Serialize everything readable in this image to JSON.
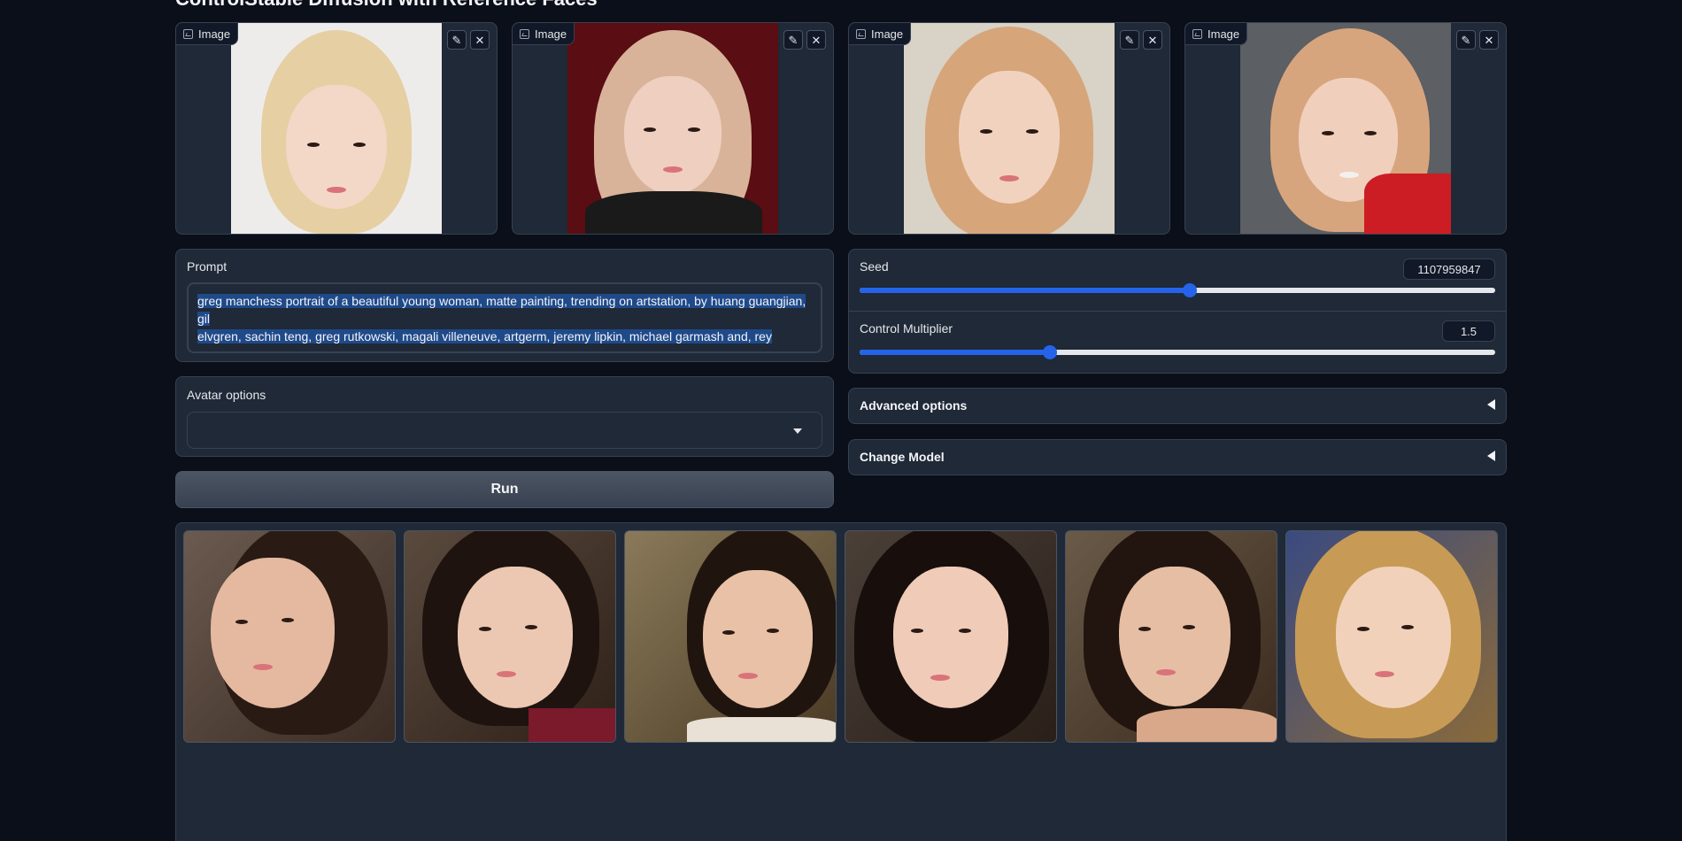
{
  "page": {
    "title": "ControlStable Diffusion with Reference Faces"
  },
  "reference_images": [
    {
      "label": "Image",
      "edit_icon": "pencil-icon",
      "close_icon": "close-icon"
    },
    {
      "label": "Image",
      "edit_icon": "pencil-icon",
      "close_icon": "close-icon"
    },
    {
      "label": "Image",
      "edit_icon": "pencil-icon",
      "close_icon": "close-icon"
    },
    {
      "label": "Image",
      "edit_icon": "pencil-icon",
      "close_icon": "close-icon"
    }
  ],
  "prompt": {
    "label": "Prompt",
    "value_line1": "greg manchess portrait of a beautiful young woman, matte painting, trending on artstation, by huang guangjian, gil",
    "value_line2": "elvgren, sachin teng, greg rutkowski, magali villeneuve, artgerm, jeremy lipkin, michael garmash and, rey"
  },
  "avatar_options": {
    "label": "Avatar options",
    "selected": ""
  },
  "run_button": {
    "label": "Run"
  },
  "seed": {
    "label": "Seed",
    "value": "1107959847",
    "fraction": 0.52
  },
  "control_multiplier": {
    "label": "Control Multiplier",
    "value": "1.5",
    "fraction": 0.3
  },
  "advanced_options": {
    "label": "Advanced options"
  },
  "change_model": {
    "label": "Change Model"
  },
  "colors": {
    "accent": "#2563eb",
    "background": "#0b0f19",
    "panel": "#1f2937"
  }
}
